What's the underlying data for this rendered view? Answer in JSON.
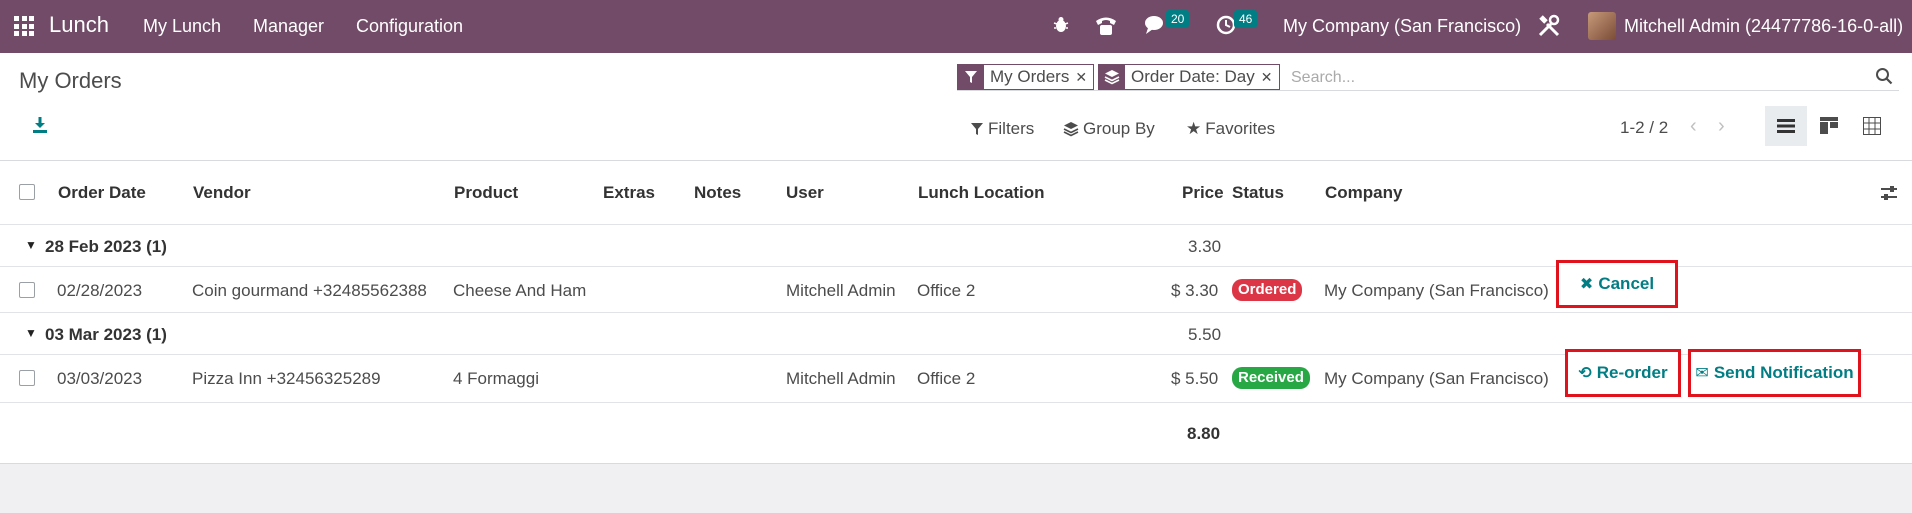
{
  "navbar": {
    "app_name": "Lunch",
    "menu": [
      "My Lunch",
      "Manager",
      "Configuration"
    ],
    "messages_count": "20",
    "activities_count": "46",
    "company": "My Company (San Francisco)",
    "user": "Mitchell Admin (24477786-16-0-all)"
  },
  "control_panel": {
    "title": "My Orders",
    "facets": [
      {
        "label": "My Orders",
        "icon": "filter-icon"
      },
      {
        "label": "Order Date: Day",
        "icon": "group-by-icon"
      }
    ],
    "search_placeholder": "Search...",
    "filters_label": "Filters",
    "group_by_label": "Group By",
    "favorites_label": "Favorites",
    "pager": "1-2 / 2"
  },
  "table": {
    "headers": [
      "Order Date",
      "Vendor",
      "Product",
      "Extras",
      "Notes",
      "User",
      "Lunch Location",
      "Price",
      "Status",
      "Company"
    ],
    "groups": [
      {
        "label": "28 Feb 2023 (1)",
        "subtotal": "3.30",
        "row": {
          "order_date": "02/28/2023",
          "vendor": "Coin gourmand +32485562388",
          "product": "Cheese And Ham",
          "user": "Mitchell Admin",
          "location": "Office 2",
          "price": "$ 3.30",
          "status": "Ordered",
          "company": "My Company (San Francisco)",
          "action_cancel": "Cancel"
        }
      },
      {
        "label": "03 Mar 2023 (1)",
        "subtotal": "5.50",
        "row": {
          "order_date": "03/03/2023",
          "vendor": "Pizza Inn +32456325289",
          "product": "4 Formaggi",
          "user": "Mitchell Admin",
          "location": "Office 2",
          "price": "$ 5.50",
          "status": "Received",
          "company": "My Company (San Francisco)",
          "action_reorder": "Re-order",
          "action_notify": "Send Notification"
        }
      }
    ],
    "total": "8.80"
  },
  "colors": {
    "brand": "#714b67",
    "accent": "#017e84",
    "ordered": "#dc3545",
    "received": "#28a745",
    "highlight": "#e0121c"
  }
}
